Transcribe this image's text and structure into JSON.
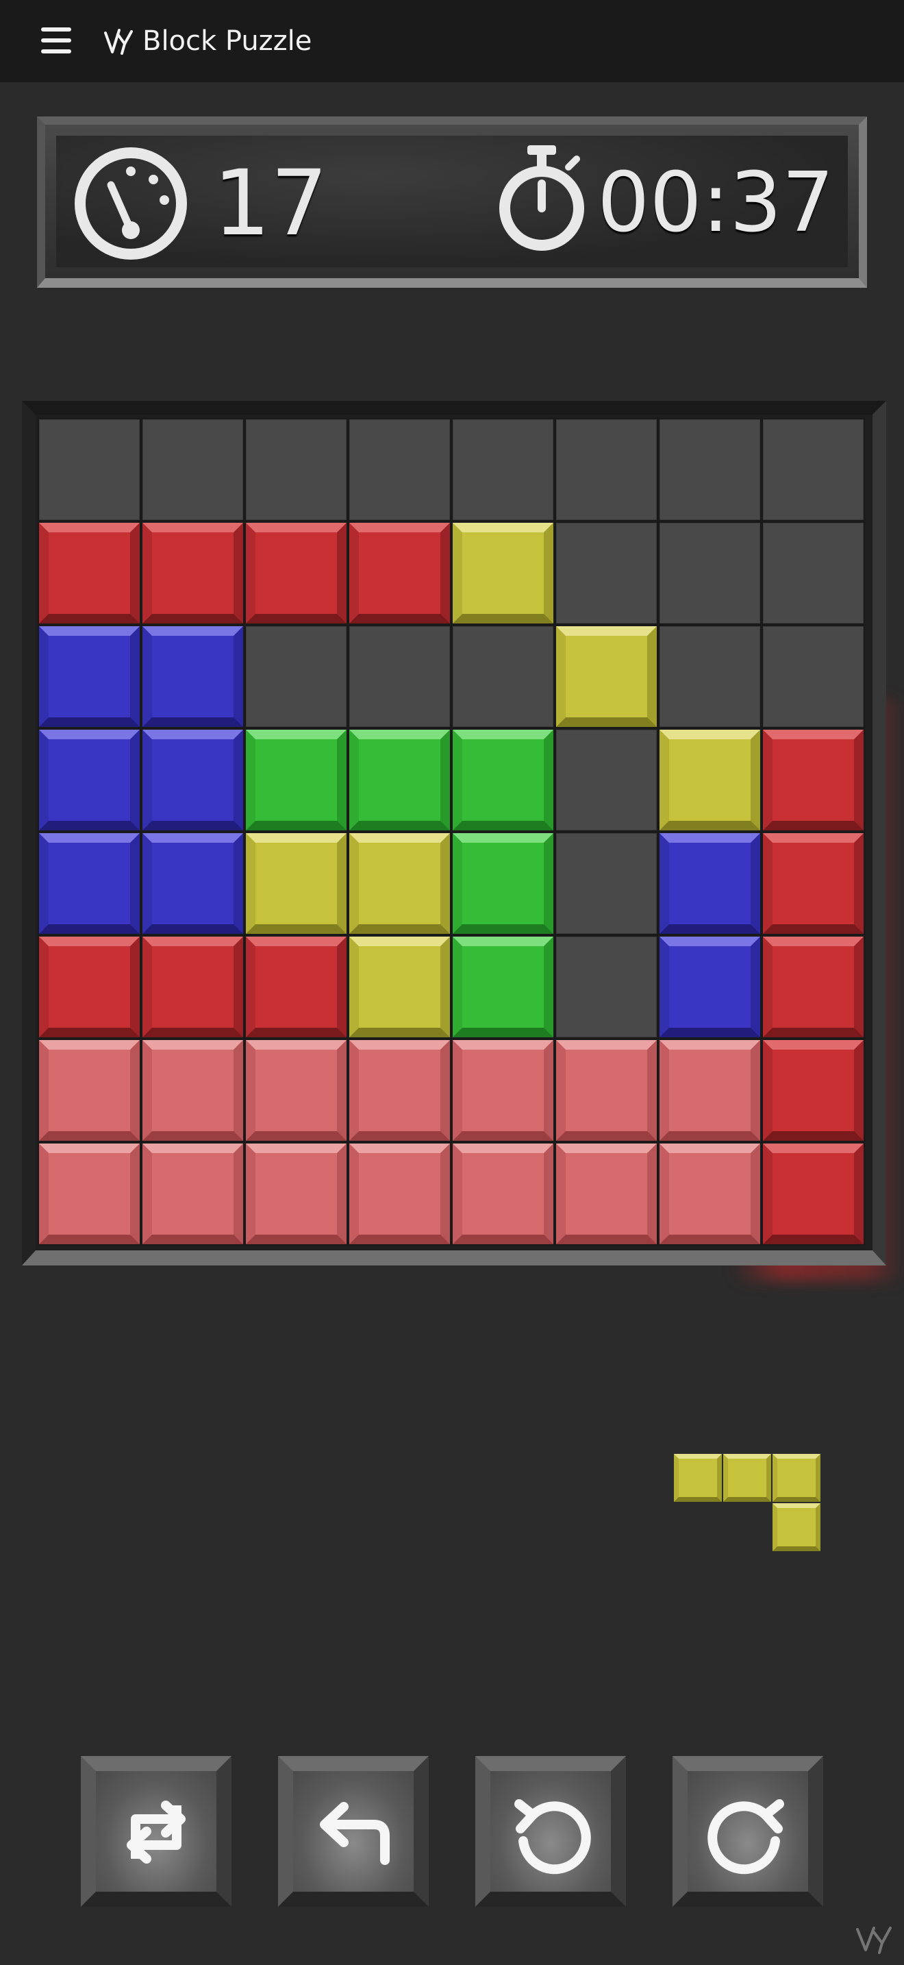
{
  "app": {
    "title": "Block Puzzle",
    "logo_icon": "vy-logo-icon",
    "menu_icon": "hamburger-menu-icon"
  },
  "stats": {
    "score": "17",
    "timer": "00:37",
    "score_icon": "speedometer-icon",
    "timer_icon": "stopwatch-icon"
  },
  "board": {
    "size": 8,
    "colors": {
      "R": "#c93033",
      "P": "#d56b6d",
      "B": "#3a35c2",
      "G": "#36bd38",
      "Y": "#c6c23c",
      "empty": "#494949"
    },
    "rows": [
      "........",
      "RRRRY...",
      "BB...Y..",
      "BBGGG.YR",
      "BBYYG.BR",
      "RRRYG.BR",
      "PPPPPPPR",
      "PPPPPPPR"
    ]
  },
  "next_piece": {
    "color": "Y",
    "cells": [
      [
        0,
        0
      ],
      [
        0,
        1
      ],
      [
        0,
        2
      ],
      [
        1,
        2
      ]
    ]
  },
  "controls": [
    {
      "name": "swap-button",
      "icon": "swap-arrows-icon"
    },
    {
      "name": "undo-button",
      "icon": "back-arrow-icon"
    },
    {
      "name": "rotate-left-button",
      "icon": "rotate-counterclockwise-icon"
    },
    {
      "name": "rotate-right-button",
      "icon": "rotate-clockwise-icon"
    }
  ]
}
